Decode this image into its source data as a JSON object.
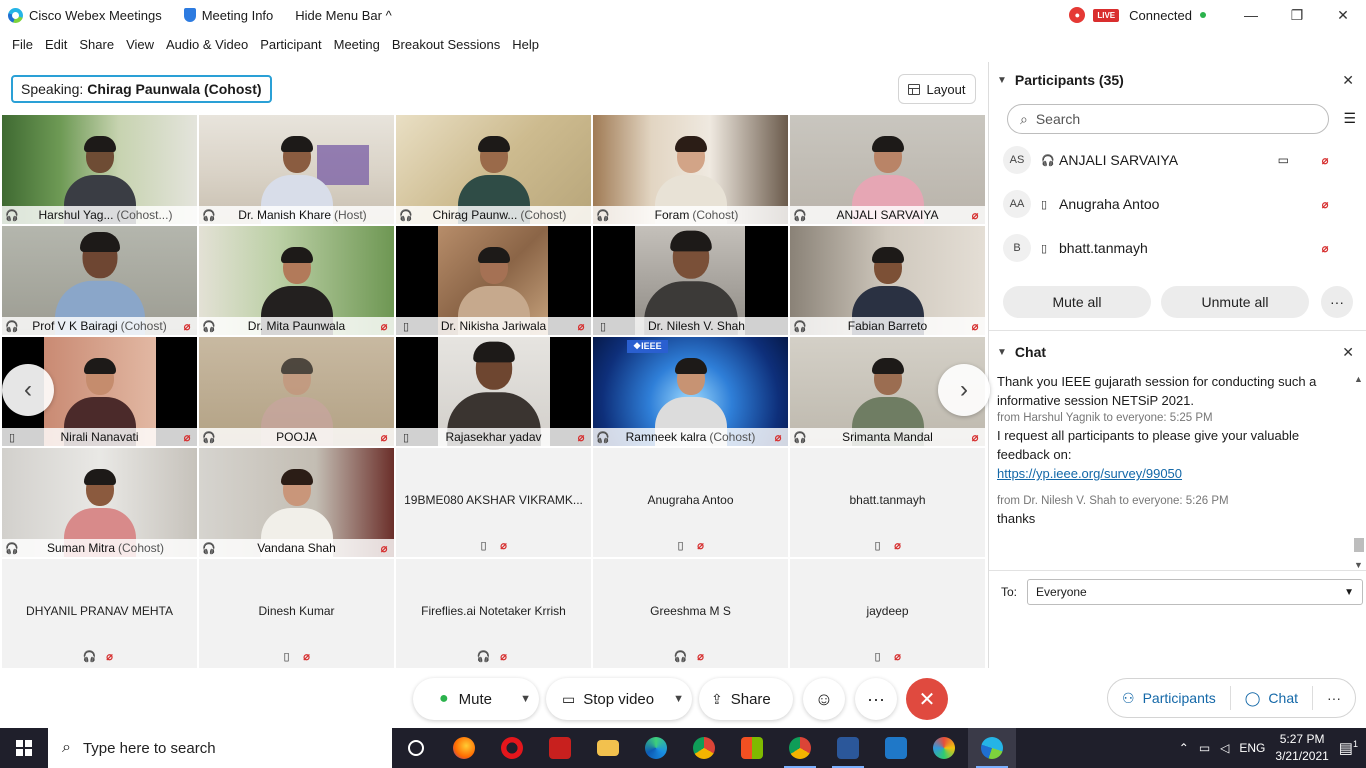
{
  "titlebar": {
    "app_title": "Cisco Webex Meetings",
    "meeting_info": "Meeting Info",
    "hide_menu": "Hide Menu Bar ^",
    "live_label": "LIVE",
    "status": "Connected"
  },
  "menu": [
    "File",
    "Edit",
    "Share",
    "View",
    "Audio & Video",
    "Participant",
    "Meeting",
    "Breakout Sessions",
    "Help"
  ],
  "speaking": {
    "label": "Speaking:",
    "name": "Chirag Paunwala (Cohost)"
  },
  "layout_button": "Layout",
  "tiles": [
    {
      "name": "Harshul Yag...",
      "role": "(Cohost...)"
    },
    {
      "name": "Dr. Manish Khare",
      "role": "(Host)"
    },
    {
      "name": "Chirag Paunw...",
      "role": "(Cohost)"
    },
    {
      "name": "Foram",
      "role": "(Cohost)"
    },
    {
      "name": "ANJALI SARVAIYA",
      "role": ""
    },
    {
      "name": "Prof V K Bairagi",
      "role": "(Cohost)"
    },
    {
      "name": "Dr. Mita Paunwala",
      "role": ""
    },
    {
      "name": "Dr. Nikisha Jariwala",
      "role": ""
    },
    {
      "name": "Dr. Nilesh V. Shah",
      "role": ""
    },
    {
      "name": "Fabian Barreto",
      "role": ""
    },
    {
      "name": "Nirali Nanavati",
      "role": ""
    },
    {
      "name": "POOJA",
      "role": ""
    },
    {
      "name": "Rajasekhar yadav",
      "role": ""
    },
    {
      "name": "Ramneek kalra",
      "role": "(Cohost)"
    },
    {
      "name": "Srimanta Mandal",
      "role": ""
    },
    {
      "name": "Suman Mitra",
      "role": "(Cohost)"
    },
    {
      "name": "Vandana Shah",
      "role": ""
    }
  ],
  "empty_tiles": [
    {
      "name": "19BME080 AKSHAR VIKRAMK..."
    },
    {
      "name": "Anugraha Antoo"
    },
    {
      "name": "bhatt.tanmayh"
    },
    {
      "name": "DHYANIL PRANAV MEHTA"
    },
    {
      "name": "Dinesh Kumar"
    },
    {
      "name": "Fireflies.ai Notetaker Krrish"
    },
    {
      "name": "Greeshma M S"
    },
    {
      "name": "jaydeep"
    }
  ],
  "ieee_logo_text": "❖IEEE",
  "controls": {
    "mute": "Mute",
    "stop_video": "Stop video",
    "share": "Share",
    "participants": "Participants",
    "chat": "Chat"
  },
  "participants_panel": {
    "title": "Participants (35)",
    "search_placeholder": "Search",
    "list": [
      {
        "initials": "AS",
        "name": "ANJALI SARVAIYA"
      },
      {
        "initials": "AA",
        "name": "Anugraha Antoo"
      },
      {
        "initials": "B",
        "name": "bhatt.tanmayh"
      }
    ],
    "mute_all": "Mute all",
    "unmute_all": "Unmute all"
  },
  "chat_panel": {
    "title": "Chat",
    "messages": [
      {
        "text": "Thank you IEEE gujarath session for conducting such a informative session NETSiP 2021."
      },
      {
        "meta": "from Harshul Yagnik to everyone:   5:25 PM"
      },
      {
        "text": "I request all participants to please give your valuable feedback on:"
      },
      {
        "link": "https://yp.ieee.org/survey/99050"
      },
      {
        "meta": "from Dr. Nilesh V. Shah to everyone:   5:26 PM"
      },
      {
        "text": "thanks"
      }
    ],
    "to_label": "To:",
    "to_value": "Everyone"
  },
  "taskbar": {
    "search_placeholder": "Type here to search",
    "lang": "ENG",
    "time": "5:27 PM",
    "date": "3/21/2021",
    "notifications": "1"
  },
  "colors": {
    "accent": "#2ab1e6",
    "end_call": "#e04a3f",
    "live": "#d92e2e",
    "link": "#1468a8"
  }
}
